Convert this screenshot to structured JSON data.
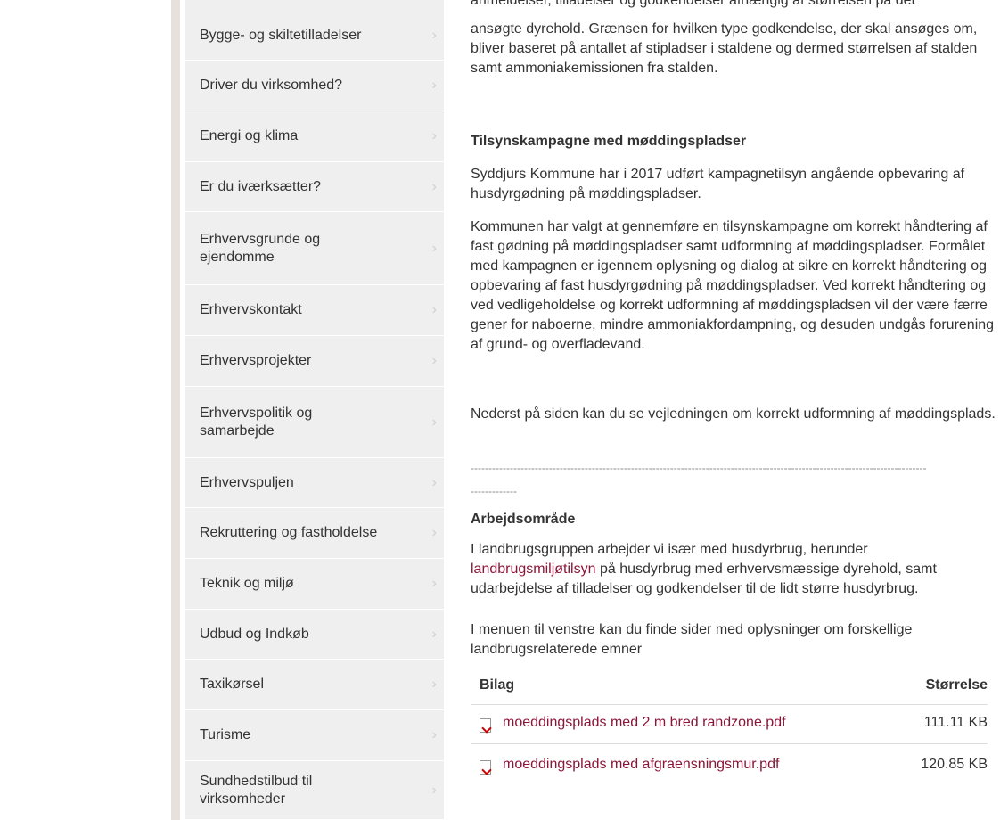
{
  "sidebar": {
    "items": [
      {
        "label": "Bygge- og skiltetilladelser"
      },
      {
        "label": "Driver du virksomhed?"
      },
      {
        "label": "Energi og klima"
      },
      {
        "label": "Er du iværksætter?"
      },
      {
        "label": "Erhvervsgrunde og ejendomme"
      },
      {
        "label": "Erhvervskontakt"
      },
      {
        "label": "Erhvervsprojekter"
      },
      {
        "label": "Erhvervspolitik og samarbejde"
      },
      {
        "label": "Erhvervspuljen"
      },
      {
        "label": "Rekruttering og fastholdelse"
      },
      {
        "label": "Teknik og miljø"
      },
      {
        "label": "Udbud og Indkøb"
      },
      {
        "label": "Taxikørsel"
      },
      {
        "label": "Turisme"
      },
      {
        "label": "Sundhedstilbud til virksomheder"
      }
    ],
    "chevron": "›"
  },
  "content": {
    "intro_cut": "anmeldelser, tilladelser og godkendelser afhængig af størrelsen på det",
    "intro_rest": "ansøgte dyrehold. Grænsen for hvilken type godkendelse, der skal ansøges om, bliver baseret på antallet af stipladser i staldene og dermed størrelsen af stalden samt ammoniakemissionen fra stalden.",
    "h_tilsyn": "Tilsynskampagne med møddingspladser",
    "p_tilsyn1": "Syddjurs Kommune har i 2017 udført kampagnetilsyn angående opbevaring af husdyrgødning på møddingspladser.",
    "p_tilsyn2": "Kommunen har valgt at gennemføre en tilsynskampagne om korrekt håndtering af fast gødning på møddingspladser samt udformning af møddingspladser. Formålet med kampagnen er igennem oplysning og dialog at sikre en korrekt håndtering og opbevaring af fast husdyrgødning på møddingspladser. Ved korrekt håndtering og ved vedligeholdelse og korrekt udformning af møddingspladsen vil der være færre gener for naboerne, mindre ammoniakfordampning, og desuden undgås forurening af grund- og overfladevand.",
    "p_tilsyn3": "Nederst på siden kan du se vejledningen om korrekt udformning af møddingsplads.",
    "dashes1": "--------------------------------------------------------------------------------------------------------------------------------",
    "dashes2": "-------------",
    "h_arbejd": "Arbejdsområde",
    "p_arbejd_pre": "I landbrugsgruppen arbejder vi især med husdyrbrug, herunder",
    "p_arbejd_link": "landbrugsmiljøtilsyn",
    "p_arbejd_post": " på husdyrbrug med erhvervsmæssige dyrehold, samt udarbejdelse af tilladelser og godkendelser til de lidt større husdyrbrug.",
    "p_menu": "I menuen til venstre kan du finde sider med oplysninger om forskellige landbrugsrelaterede emner"
  },
  "attachments": {
    "header_name": "Bilag",
    "header_size": "Størrelse",
    "files": [
      {
        "name": "moeddingsplads med 2 m bred randzone.pdf",
        "size": "111.11 KB"
      },
      {
        "name": "moeddingsplads med afgraensningsmur.pdf",
        "size": "120.85 KB"
      }
    ]
  }
}
